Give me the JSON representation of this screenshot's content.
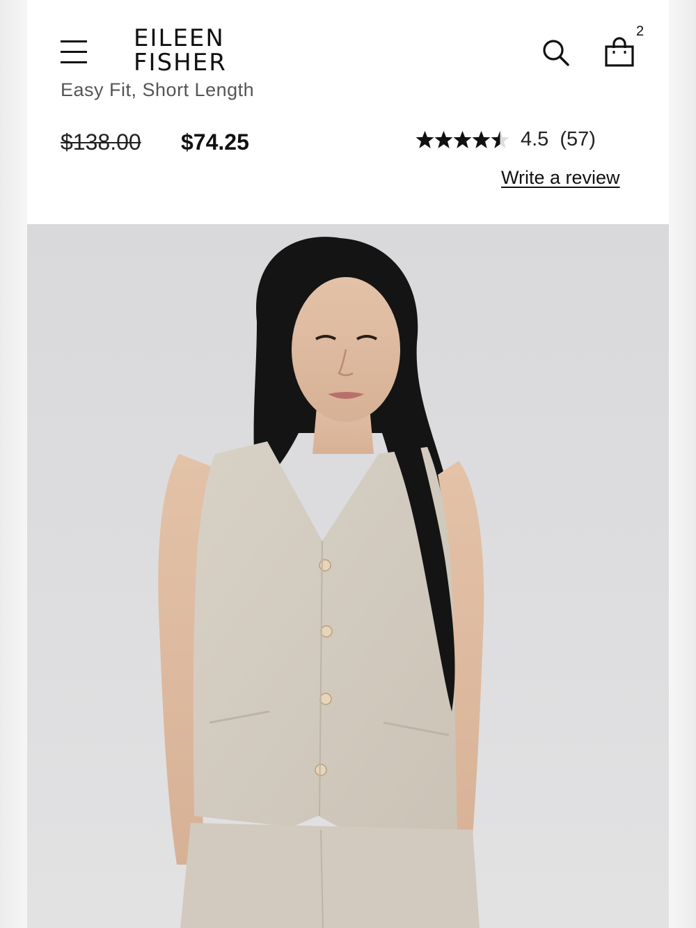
{
  "header": {
    "brand_line1": "EILEEN",
    "brand_line2": "FISHER",
    "cart_count": "2"
  },
  "product": {
    "subtitle": "Easy Fit, Short Length",
    "price_original": "$138.00",
    "price_sale": "$74.25",
    "rating_value": "4.5",
    "rating_count": "(57)",
    "rating_stars": 4.5,
    "write_review_label": "Write a review"
  },
  "colors": {
    "background": "#ffffff",
    "text": "#111111",
    "subtitle": "#555555",
    "photo_background": "#dcdcde",
    "linen": "#d6cfc4"
  },
  "icons": {
    "menu": "hamburger-icon",
    "search": "search-icon",
    "bag": "shopping-bag-icon",
    "star": "star-icon"
  }
}
